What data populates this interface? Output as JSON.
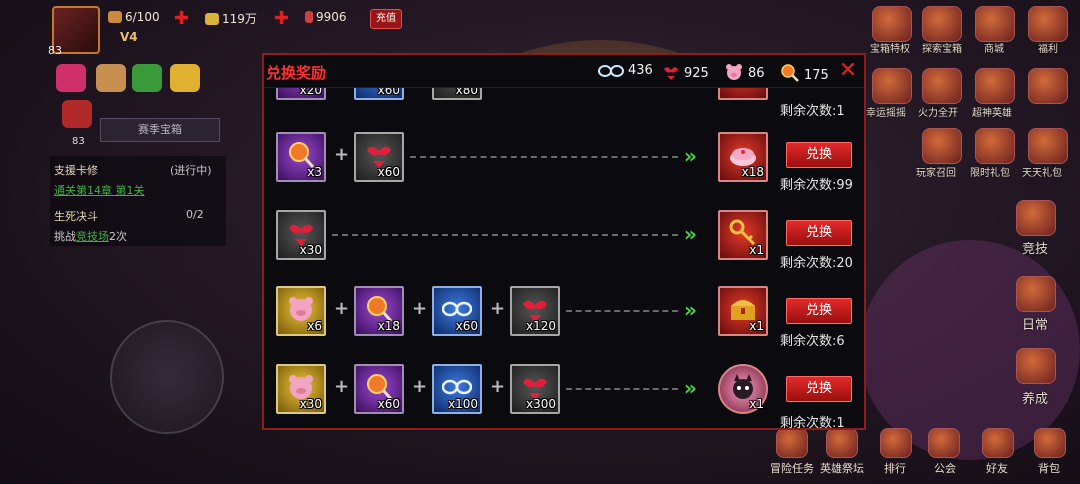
{
  "hud": {
    "avatar_level": "83",
    "stamina": "6/100",
    "gold": "119万",
    "gems": "9906",
    "recharge_label": "充值",
    "vip": "V4"
  },
  "left_panel": {
    "season_chest": "赛季宝箱",
    "chest_level": "83",
    "quest1_title": "支援卡修",
    "quest1_status": "(进行中)",
    "quest1_desc": "通关第14章 第1关",
    "quest2_title": "生死决斗",
    "quest2_progress": "0/2",
    "quest2_desc_prefix": "挑战",
    "quest2_desc_link": "竞技场",
    "quest2_desc_suffix": "2次"
  },
  "right_menu": {
    "labels": [
      "宝箱特权",
      "探索宝箱",
      "商城",
      "福利",
      "幸运摇摇",
      "火力全开",
      "超神英雄",
      "玩家召回",
      "限时礼包",
      "天天礼包",
      "竞技",
      "日常",
      "养成"
    ]
  },
  "bottom_menu": {
    "labels": [
      "冒险任务",
      "英雄祭坛",
      "排行",
      "公会",
      "好友",
      "背包"
    ]
  },
  "dialog": {
    "title": "兑换奖励",
    "currencies": [
      {
        "icon": "glasses-icon",
        "value": "436"
      },
      {
        "icon": "bikini-icon",
        "value": "925"
      },
      {
        "icon": "pig-icon",
        "value": "86"
      },
      {
        "icon": "lollipop-icon",
        "value": "175"
      }
    ],
    "partial_row": {
      "costs": [
        "x20",
        "x60",
        "x80"
      ],
      "remaining": "剩余次数:1"
    },
    "rows": [
      {
        "costs": [
          {
            "icon": "lollipop-icon",
            "color": "purple",
            "qty": "x3"
          },
          {
            "icon": "bikini-icon",
            "color": "gray",
            "qty": "x60"
          }
        ],
        "reward": {
          "icon": "cake-icon",
          "color": "red",
          "qty": "x18"
        },
        "button": "兑换",
        "remaining": "剩余次数:99"
      },
      {
        "costs": [
          {
            "icon": "bikini-icon",
            "color": "gray",
            "qty": "x30"
          }
        ],
        "reward": {
          "icon": "key-icon",
          "color": "red",
          "qty": "x1"
        },
        "button": "兑换",
        "remaining": "剩余次数:20"
      },
      {
        "costs": [
          {
            "icon": "pig-icon",
            "color": "yellow",
            "qty": "x6"
          },
          {
            "icon": "lollipop-icon",
            "color": "purple",
            "qty": "x18"
          },
          {
            "icon": "glasses-icon",
            "color": "blue",
            "qty": "x60"
          },
          {
            "icon": "bikini-icon",
            "color": "gray",
            "qty": "x120"
          }
        ],
        "reward": {
          "icon": "chest-icon",
          "color": "red",
          "qty": "x1"
        },
        "button": "兑换",
        "remaining": "剩余次数:6"
      },
      {
        "costs": [
          {
            "icon": "pig-icon",
            "color": "yellow",
            "qty": "x30"
          },
          {
            "icon": "lollipop-icon",
            "color": "purple",
            "qty": "x60"
          },
          {
            "icon": "glasses-icon",
            "color": "blue",
            "qty": "x100"
          },
          {
            "icon": "bikini-icon",
            "color": "gray",
            "qty": "x300"
          }
        ],
        "reward": {
          "icon": "cat-avatar-icon",
          "color": "red",
          "qty": "x1"
        },
        "button": "兑换",
        "remaining": "剩余次数:1"
      }
    ]
  }
}
